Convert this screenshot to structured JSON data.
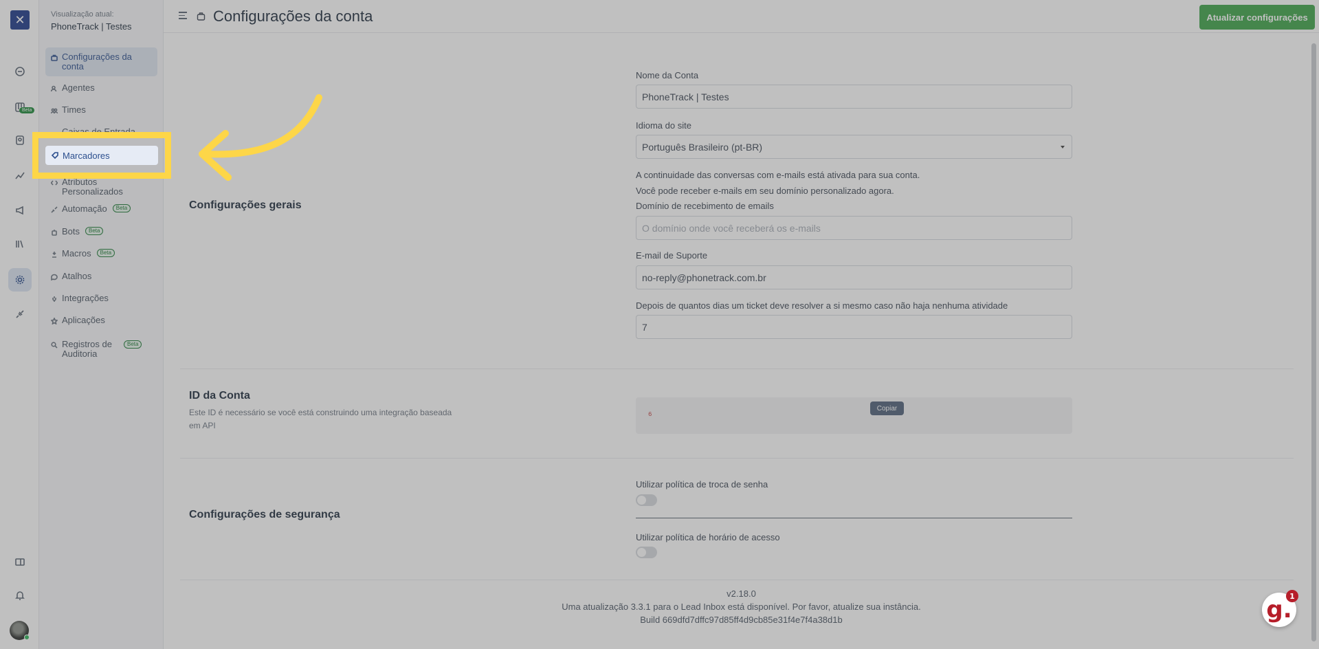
{
  "app": {
    "logo_glyph": "✕"
  },
  "sidebar": {
    "view_label": "Visualização atual:",
    "view_value": "PhoneTrack | Testes",
    "items": [
      {
        "label": "Configurações da conta",
        "icon": "briefcase-icon"
      },
      {
        "label": "Agentes",
        "icon": "users-icon"
      },
      {
        "label": "Times",
        "icon": "team-icon"
      },
      {
        "label": "Caixas de Entrada",
        "icon": "inbox-icon"
      },
      {
        "label": "Marcadores",
        "icon": "tag-icon"
      },
      {
        "label": "Atributos Personalizados",
        "icon": "code-icon"
      },
      {
        "label": "Automação",
        "icon": "automation-icon",
        "badge": "Beta"
      },
      {
        "label": "Bots",
        "icon": "bot-icon",
        "badge": "Beta"
      },
      {
        "label": "Macros",
        "icon": "macro-icon",
        "badge": "Beta"
      },
      {
        "label": "Atalhos",
        "icon": "shortcut-icon"
      },
      {
        "label": "Integrações",
        "icon": "plug-icon"
      },
      {
        "label": "Aplicações",
        "icon": "apps-icon"
      },
      {
        "label": "Registros de Auditoria",
        "icon": "audit-icon",
        "badge": "Beta"
      }
    ],
    "rail_beta": "Beta"
  },
  "header": {
    "title": "Configurações da conta",
    "update_button": "Atualizar configurações"
  },
  "general": {
    "title": "Configurações gerais",
    "account_name_label": "Nome da Conta",
    "account_name_value": "PhoneTrack | Testes",
    "language_label": "Idioma do site",
    "language_value": "Português Brasileiro (pt-BR)",
    "info_line1": "A continuidade das conversas com e-mails está ativada para sua conta.",
    "info_line2": "Você pode receber e-mails em seu domínio personalizado agora.",
    "domain_label": "Domínio de recebimento de emails",
    "domain_placeholder": "O domínio onde você receberá os e-mails",
    "support_email_label": "E-mail de Suporte",
    "support_email_value": "no-reply@phonetrack.com.br",
    "auto_resolve_label": "Depois de quantos dias um ticket deve resolver a si mesmo caso não haja nenhuma atividade",
    "auto_resolve_value": "7"
  },
  "account_id": {
    "title": "ID da Conta",
    "subtitle": "Este ID é necessário se você está construindo uma integração baseada em API",
    "value": "6",
    "copy_button": "Copiar"
  },
  "security": {
    "title": "Configurações de segurança",
    "password_policy_label": "Utilizar política de troca de senha",
    "password_policy_on": false,
    "access_hours_label": "Utilizar política de horário de acesso",
    "access_hours_on": false
  },
  "footer": {
    "version": "v2.18.0",
    "update_notice": "Uma atualização 3.3.1 para o Lead Inbox está disponível. Por favor, atualize sua instância.",
    "build": "Build 669dfd7dffc97d85ff4d9cb85e31f4e7f4a38d1b"
  },
  "chat_widget": {
    "glyph": "g.",
    "count": "1"
  },
  "highlight": {
    "color": "#fdd648"
  }
}
